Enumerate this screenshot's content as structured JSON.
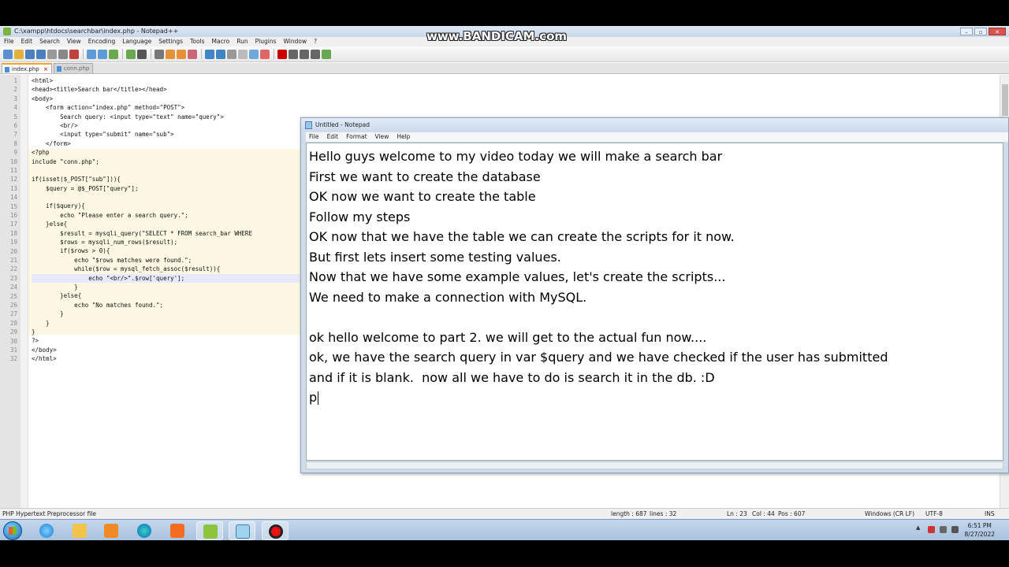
{
  "npp": {
    "title": "C:\\xampp\\htdocs\\searchbar\\index.php - Notepad++",
    "menu": [
      "File",
      "Edit",
      "Search",
      "View",
      "Encoding",
      "Language",
      "Settings",
      "Tools",
      "Macro",
      "Run",
      "Plugins",
      "Window",
      "?"
    ],
    "tabs": [
      {
        "label": "index.php",
        "close": "×"
      },
      {
        "label": "conn.php"
      }
    ],
    "code_lines": [
      "<html>",
      "<head><title>Search bar</title></head>",
      "<body>",
      "    <form action=\"index.php\" method=\"POST\">",
      "        Search query: <input type=\"text\" name=\"query\">",
      "        <br/>",
      "        <input type=\"submit\" name=\"sub\">",
      "    </form>",
      "<?php",
      "include \"conn.php\";",
      "",
      "if(isset($_POST[\"sub\"])){",
      "    $query = @$_POST[\"query\"];",
      "",
      "    if($query){",
      "        echo \"Please enter a search query.\";",
      "    }else{",
      "        $result = mysqli_query(\"SELECT * FROM search_bar WHERE",
      "        $rows = mysqli_num_rows($result);",
      "        if($rows > 0){",
      "            echo \"$rows matches were found.\";",
      "            while($row = mysql_fetch_assoc($result)){",
      "                echo \"<br/>\".$row['query'];",
      "            }",
      "        }else{",
      "            echo \"No matches found.\";",
      "        }",
      "    }",
      "}",
      "?>",
      "</body>",
      "</html>"
    ],
    "status": {
      "file_type": "PHP Hypertext Preprocessor file",
      "length": "length : 687",
      "lines": "lines : 32",
      "ln": "Ln : 23",
      "col": "Col : 44",
      "pos": "Pos : 607",
      "eol": "Windows (CR LF)",
      "encoding": "UTF-8",
      "mode": "INS"
    }
  },
  "notepad": {
    "title": "Untitled - Notepad",
    "menu": [
      "File",
      "Edit",
      "Format",
      "View",
      "Help"
    ],
    "lines": [
      "Hello guys welcome to my video today we will make a search bar",
      "First we want to create the database",
      "OK now we want to create the table",
      "Follow my steps",
      "OK now that we have the table we can create the scripts for it now.",
      "But first lets insert some testing values.",
      "Now that we have some example values, let's create the scripts...",
      "We need to make a connection with MySQL.",
      "",
      "ok hello welcome to part 2. we will get to the actual fun now....",
      "ok, we have the search query in var $query and we have checked if the user has submitted",
      "and if it is blank.  now all we have to do is search it in the db. :D",
      "p"
    ]
  },
  "watermark": "www.BANDICAM.com",
  "taskbar": {
    "apps": [
      "start-orb",
      "internet-explorer-icon",
      "file-explorer-icon",
      "media-player-icon",
      "edge-icon",
      "xampp-icon",
      "notepad-plus-plus-icon",
      "notepad-icon",
      "bandicam-record-icon"
    ],
    "time": "6:51 PM",
    "date": "8/27/2022"
  },
  "colors": {
    "accent_tab": "#f3a52a",
    "keyword_blue": "#0000ff",
    "string_gray": "#808080",
    "php_bg": "#fdf8e3"
  }
}
